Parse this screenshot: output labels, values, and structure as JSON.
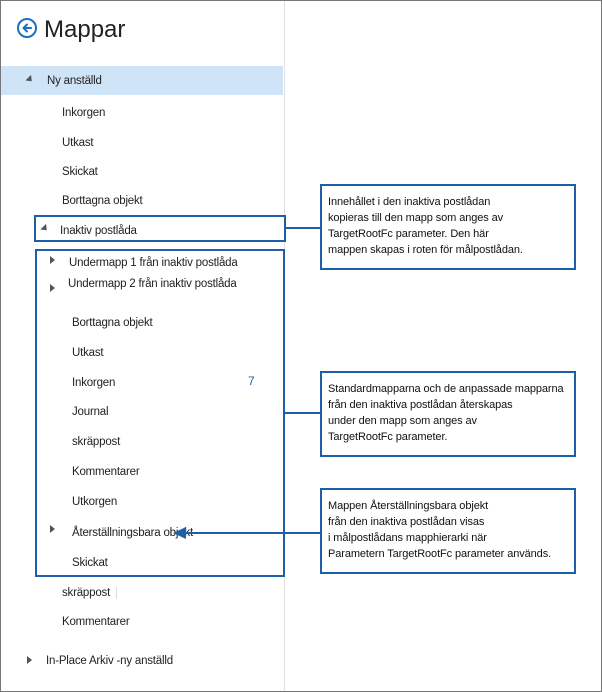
{
  "header": {
    "title": "Mappar",
    "back_icon": "arrow-left-circle-icon"
  },
  "tree": {
    "root_label": "Ny anställd",
    "root_children": [
      "Inkorgen",
      "Utkast",
      "Skickat",
      "Borttagna objekt"
    ],
    "inactive_label": "Inaktiv postlåda",
    "sub1": "Undermapp 1 från inaktiv postlåda",
    "sub2": "Undermapp 2 från inaktiv postlåda",
    "inactive_children": [
      "Borttagna objekt",
      "Utkast",
      "Inkorgen",
      "Journal",
      "skräppost",
      "Kommentarer",
      "Utkorgen",
      "Återställningsbara objekt",
      "Skickat"
    ],
    "inbox_count": "7",
    "after_items": [
      "skräppost",
      "Kommentarer"
    ],
    "archive_label": "In-Place Arkiv -ny anställd"
  },
  "callouts": {
    "c1": [
      "Innehållet i den inaktiva postlådan",
      "kopieras till den mapp som anges av",
      "TargetRootFc parameter. Den här",
      "mappen skapas i roten för målpostlådan."
    ],
    "c2": [
      "Standardmapparna och de anpassade mapparna",
      "från den inaktiva postlådan återskapas",
      "under den mapp som anges av",
      "TargetRootFc parameter."
    ],
    "c3": [
      "Mappen Återställningsbara objekt",
      "från den inaktiva postlådan visas",
      "i målpostlådans mapphierarki när",
      "Parametern TargetRootFc parameter används."
    ]
  },
  "colors": {
    "accent": "#1f5fa8",
    "selection": "#cfe4f7"
  }
}
